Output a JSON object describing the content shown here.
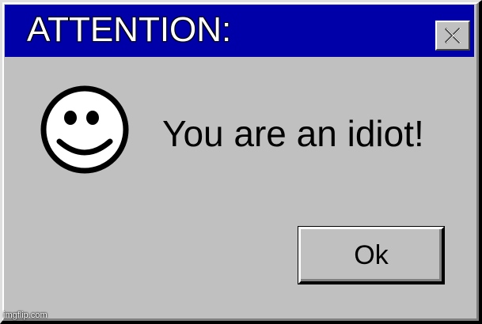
{
  "dialog": {
    "title": "ATTENTION:",
    "message": "You are an idiot!",
    "ok_label": "Ok",
    "icon": "smiley-face-icon",
    "close_icon": "close-icon"
  },
  "watermark": "imgflip.com",
  "colors": {
    "titlebar": "#0000a8",
    "face": "#c0c0c0",
    "title_text": "#ffffff"
  }
}
